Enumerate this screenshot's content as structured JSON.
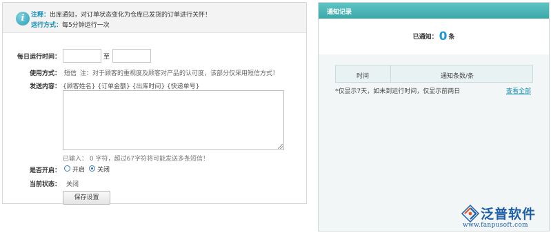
{
  "notice": {
    "note_label": "注释：",
    "note_text": "出库通知，对订单状态变化为仓库已发货的订单进行关怀！",
    "run_label": "运行方式：",
    "run_text": "每5分钟运行一次"
  },
  "form": {
    "daily_time_label": "每日运行时间：",
    "time_sep": "至",
    "start_time_value": "",
    "end_time_value": "",
    "method_label": "使用方式：",
    "method_value": "短信",
    "method_note": "注：对于顾客的重视度及顾客对产品的认可度，该部分仅采用短信方式！",
    "content_label": "发送内容：",
    "content_tags": "{顾客姓名} {订单金额} {出库时间} {快递单号}",
    "content_value": "",
    "char_count_prefix": "已输入：",
    "char_count": "0",
    "char_count_suffix": "字符，超过67字符将可能发送多条短信！",
    "enable_label": "是否开启：",
    "enable_options": [
      "开启",
      "关闭"
    ],
    "enable_selected": "关闭",
    "status_label": "当前状态：",
    "status_value": "关闭",
    "save_label": "保存设置"
  },
  "records": {
    "title": "通知记录",
    "notified_prefix": "已通知：",
    "notified_count": "0",
    "notified_unit": "条",
    "columns": [
      "时间",
      "通知条数/条"
    ],
    "rows": [],
    "note": "*仅显示7天，如未到运行时间，仅显示前两日",
    "view_all": "查看全部"
  },
  "logo": {
    "name": "泛普软件",
    "url": "www.fanpusoft.com"
  },
  "colors": {
    "accent": "#1a8fb3",
    "header_teal": "#4bb6b6",
    "logo_blue": "#1d5ea8"
  }
}
